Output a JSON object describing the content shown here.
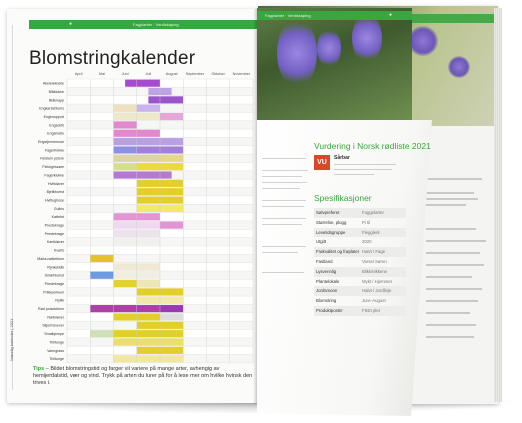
{
  "left_page": {
    "header_text": "Fagplanter · Verdiskaping",
    "title": "Blomstringkalender",
    "side_text": "Naturlig kalender | 2021",
    "months": [
      "April",
      "Mai",
      "Juni",
      "Juli",
      "August",
      "September",
      "Oktober",
      "November"
    ],
    "species": [
      "Akeleieknelle",
      "Blåklokke",
      "Blåknapp",
      "Engkarsebloms",
      "Engknoppurt",
      "Engsolrik",
      "Engsmelle",
      "Engstjernemose",
      "Fagerfrekke",
      "Fetstein pstore",
      "Flekkgrissøre",
      "Fagerklokke",
      "Hvitkløver",
      "Bjellblomst",
      "Hvittuglrose",
      "Gullris",
      "Kattefot",
      "Prestekrage",
      "Prestekrage",
      "Kantkløver",
      "Kvarts",
      "Maria-nøkleblom",
      "Rynkeblåk",
      "Smørblomst",
      "Prestekrage",
      "Prikkperikum",
      "Ryllik",
      "Rød jonsokblom",
      "Rødkløver",
      "Skjermsvever",
      "Smalkjempe",
      "Tiriltunge",
      "Vanngrass",
      "Tiriltunge"
    ],
    "footnote_tip": "Tips",
    "footnote_text": "– Bildet blomstringstid og farger vil variere på mange arter, avhengig av hemijerdalstid, vær og vind. Trykk på arten du lurer på for å lese mer om hvilke hvinsk den trives i."
  },
  "right_page": {
    "header_text": "Fagplanter · Verdiskaping",
    "assessment_title": "Vurdering i Norsk rødliste 2021",
    "vu_code": "VU",
    "vu_label": "Sårbar",
    "specs_title": "Spesifikasjoner",
    "specs": [
      {
        "key": "Sølvpreferet",
        "value": "Fuggelarter"
      },
      {
        "key": "Størrelse, plugg",
        "value": "Pi til"
      },
      {
        "key": "Levetidsgruppe",
        "value": "Flegglerk"
      },
      {
        "key": "Utgitt",
        "value": "2020"
      },
      {
        "key": "Frøkvalitet og frøplater",
        "value": "Halvt / Fage"
      },
      {
        "key": "Fastland",
        "value": "Varsel Søren"
      },
      {
        "key": "Lysvennlig",
        "value": "Blikk/eikkene"
      },
      {
        "key": "Plantelokale",
        "value": "Mykt / Hjemmet"
      },
      {
        "key": "Jordsmonn",
        "value": "Halvt / Jordlinje"
      },
      {
        "key": "Blomstring",
        "value": "Juni–August"
      },
      {
        "key": "Produktpostnr",
        "value": "FSDI plet"
      }
    ]
  },
  "colors": {
    "accent_green": "#3aa63f",
    "vu_red": "#d64a2a"
  },
  "chart_data": {
    "type": "heatmap",
    "title": "Blomstringkalender",
    "x_categories": [
      "April",
      "Mai",
      "Juni",
      "Juli",
      "August",
      "September",
      "Oktober",
      "November"
    ],
    "rows": [
      {
        "name": "Akeleieknelle",
        "bars": [
          {
            "from": 2.5,
            "to": 4.0,
            "color": "#a64ad0"
          }
        ]
      },
      {
        "name": "Blåklokke",
        "bars": [
          {
            "from": 3.5,
            "to": 4.5,
            "color": "#bca3e3"
          }
        ]
      },
      {
        "name": "Blåknapp",
        "bars": [
          {
            "from": 3.5,
            "to": 5.0,
            "color": "#9a56c9"
          }
        ]
      },
      {
        "name": "Engkarsebloms",
        "bars": [
          {
            "from": 2.0,
            "to": 3.0,
            "color": "#efe0bf"
          },
          {
            "from": 3.0,
            "to": 4.0,
            "color": "#c9b4ec"
          }
        ]
      },
      {
        "name": "Engknoppurt",
        "bars": [
          {
            "from": 2.0,
            "to": 4.0,
            "color": "#ede8c6"
          },
          {
            "from": 4.0,
            "to": 5.0,
            "color": "#e3a8d8"
          }
        ]
      },
      {
        "name": "Engsolrik",
        "bars": [
          {
            "from": 2.0,
            "to": 3.0,
            "color": "#e288cd"
          }
        ]
      },
      {
        "name": "Engsmelle",
        "bars": [
          {
            "from": 2.0,
            "to": 4.0,
            "color": "#e288cd"
          }
        ]
      },
      {
        "name": "Engstjernemose",
        "bars": [
          {
            "from": 2.0,
            "to": 5.0,
            "color": "#b9a0e3"
          }
        ]
      },
      {
        "name": "Fagerfrekke",
        "bars": [
          {
            "from": 2.0,
            "to": 3.0,
            "color": "#8f8fe0"
          },
          {
            "from": 3.0,
            "to": 5.0,
            "color": "#a27fd8"
          }
        ]
      },
      {
        "name": "Fetstein pstore",
        "bars": [
          {
            "from": 2.0,
            "to": 4.0,
            "color": "#ddd4a6"
          },
          {
            "from": 4.0,
            "to": 5.0,
            "color": "#e5d88a"
          }
        ]
      },
      {
        "name": "Flekkgrissøre",
        "bars": [
          {
            "from": 2.0,
            "to": 3.0,
            "color": "#d6e086"
          },
          {
            "from": 3.0,
            "to": 5.0,
            "color": "#e9db3a"
          }
        ]
      },
      {
        "name": "Fagerklokke",
        "bars": [
          {
            "from": 2.0,
            "to": 4.5,
            "color": "#b478d6"
          }
        ]
      },
      {
        "name": "Hvitkløver",
        "bars": [
          {
            "from": 3.0,
            "to": 5.0,
            "color": "#e3cf2c"
          }
        ]
      },
      {
        "name": "Bjellblomst",
        "bars": [
          {
            "from": 3.0,
            "to": 5.0,
            "color": "#e3cf2c"
          }
        ]
      },
      {
        "name": "Hvittuglrose",
        "bars": [
          {
            "from": 3.0,
            "to": 5.0,
            "color": "#e3cf2c"
          }
        ]
      },
      {
        "name": "Gullris",
        "bars": [
          {
            "from": 3.0,
            "to": 5.0,
            "color": "#f2e96a"
          }
        ]
      },
      {
        "name": "Kattefot",
        "bars": [
          {
            "from": 2.0,
            "to": 4.0,
            "color": "#e394d4"
          }
        ]
      },
      {
        "name": "Prestekrage",
        "bars": [
          {
            "from": 2.0,
            "to": 4.0,
            "color": "#efd9f0"
          },
          {
            "from": 4.0,
            "to": 5.0,
            "color": "#e394d4"
          }
        ]
      },
      {
        "name": "Prestekrage",
        "bars": [
          {
            "from": 2.0,
            "to": 4.0,
            "color": "#ede3ea"
          }
        ]
      },
      {
        "name": "Kantkløver",
        "bars": [
          {
            "from": 2.0,
            "to": 4.0,
            "color": "#f0f0ee"
          }
        ]
      },
      {
        "name": "Kvarts",
        "bars": []
      },
      {
        "name": "Maria-nøkleblom",
        "bars": [
          {
            "from": 1.0,
            "to": 2.0,
            "color": "#e3c22c"
          }
        ]
      },
      {
        "name": "Rynkeblåk",
        "bars": [
          {
            "from": 2.0,
            "to": 4.0,
            "color": "#efe9d4"
          }
        ]
      },
      {
        "name": "Smørblomst",
        "bars": [
          {
            "from": 1.0,
            "to": 2.0,
            "color": "#6d9be2"
          },
          {
            "from": 2.0,
            "to": 4.0,
            "color": "#f0eee0"
          }
        ]
      },
      {
        "name": "Prestekrage",
        "bars": [
          {
            "from": 2.0,
            "to": 3.0,
            "color": "#e3d42c"
          },
          {
            "from": 3.0,
            "to": 4.0,
            "color": "#efe6b8"
          }
        ]
      },
      {
        "name": "Prikkperikum",
        "bars": [
          {
            "from": 3.0,
            "to": 5.0,
            "color": "#e3cf2c"
          }
        ]
      },
      {
        "name": "Ryllik",
        "bars": [
          {
            "from": 3.0,
            "to": 5.0,
            "color": "#f2e8a8"
          }
        ]
      },
      {
        "name": "Rød jonsokblom",
        "bars": [
          {
            "from": 1.0,
            "to": 4.0,
            "color": "#b03ea8"
          },
          {
            "from": 4.0,
            "to": 5.0,
            "color": "#9a3ab2"
          }
        ]
      },
      {
        "name": "Rødkløver",
        "bars": [
          {
            "from": 2.0,
            "to": 4.0,
            "color": "#e3cf2c"
          },
          {
            "from": 4.0,
            "to": 5.0,
            "color": "#ddd"
          }
        ]
      },
      {
        "name": "Skjermsvever",
        "bars": [
          {
            "from": 3.0,
            "to": 5.0,
            "color": "#e3cf2c"
          }
        ]
      },
      {
        "name": "Smalkjempe",
        "bars": [
          {
            "from": 1.0,
            "to": 2.0,
            "color": "#cfe0b8"
          },
          {
            "from": 2.0,
            "to": 5.0,
            "color": "#e3cf2c"
          }
        ]
      },
      {
        "name": "Tiriltunge",
        "bars": [
          {
            "from": 2.0,
            "to": 5.0,
            "color": "#e9df6a"
          }
        ]
      },
      {
        "name": "Vanngrass",
        "bars": [
          {
            "from": 3.0,
            "to": 5.0,
            "color": "#e3cf2c"
          }
        ]
      },
      {
        "name": "Tiriltunge",
        "bars": [
          {
            "from": 2.0,
            "to": 5.0,
            "color": "#f0e8a0"
          }
        ]
      }
    ],
    "grid": true
  }
}
